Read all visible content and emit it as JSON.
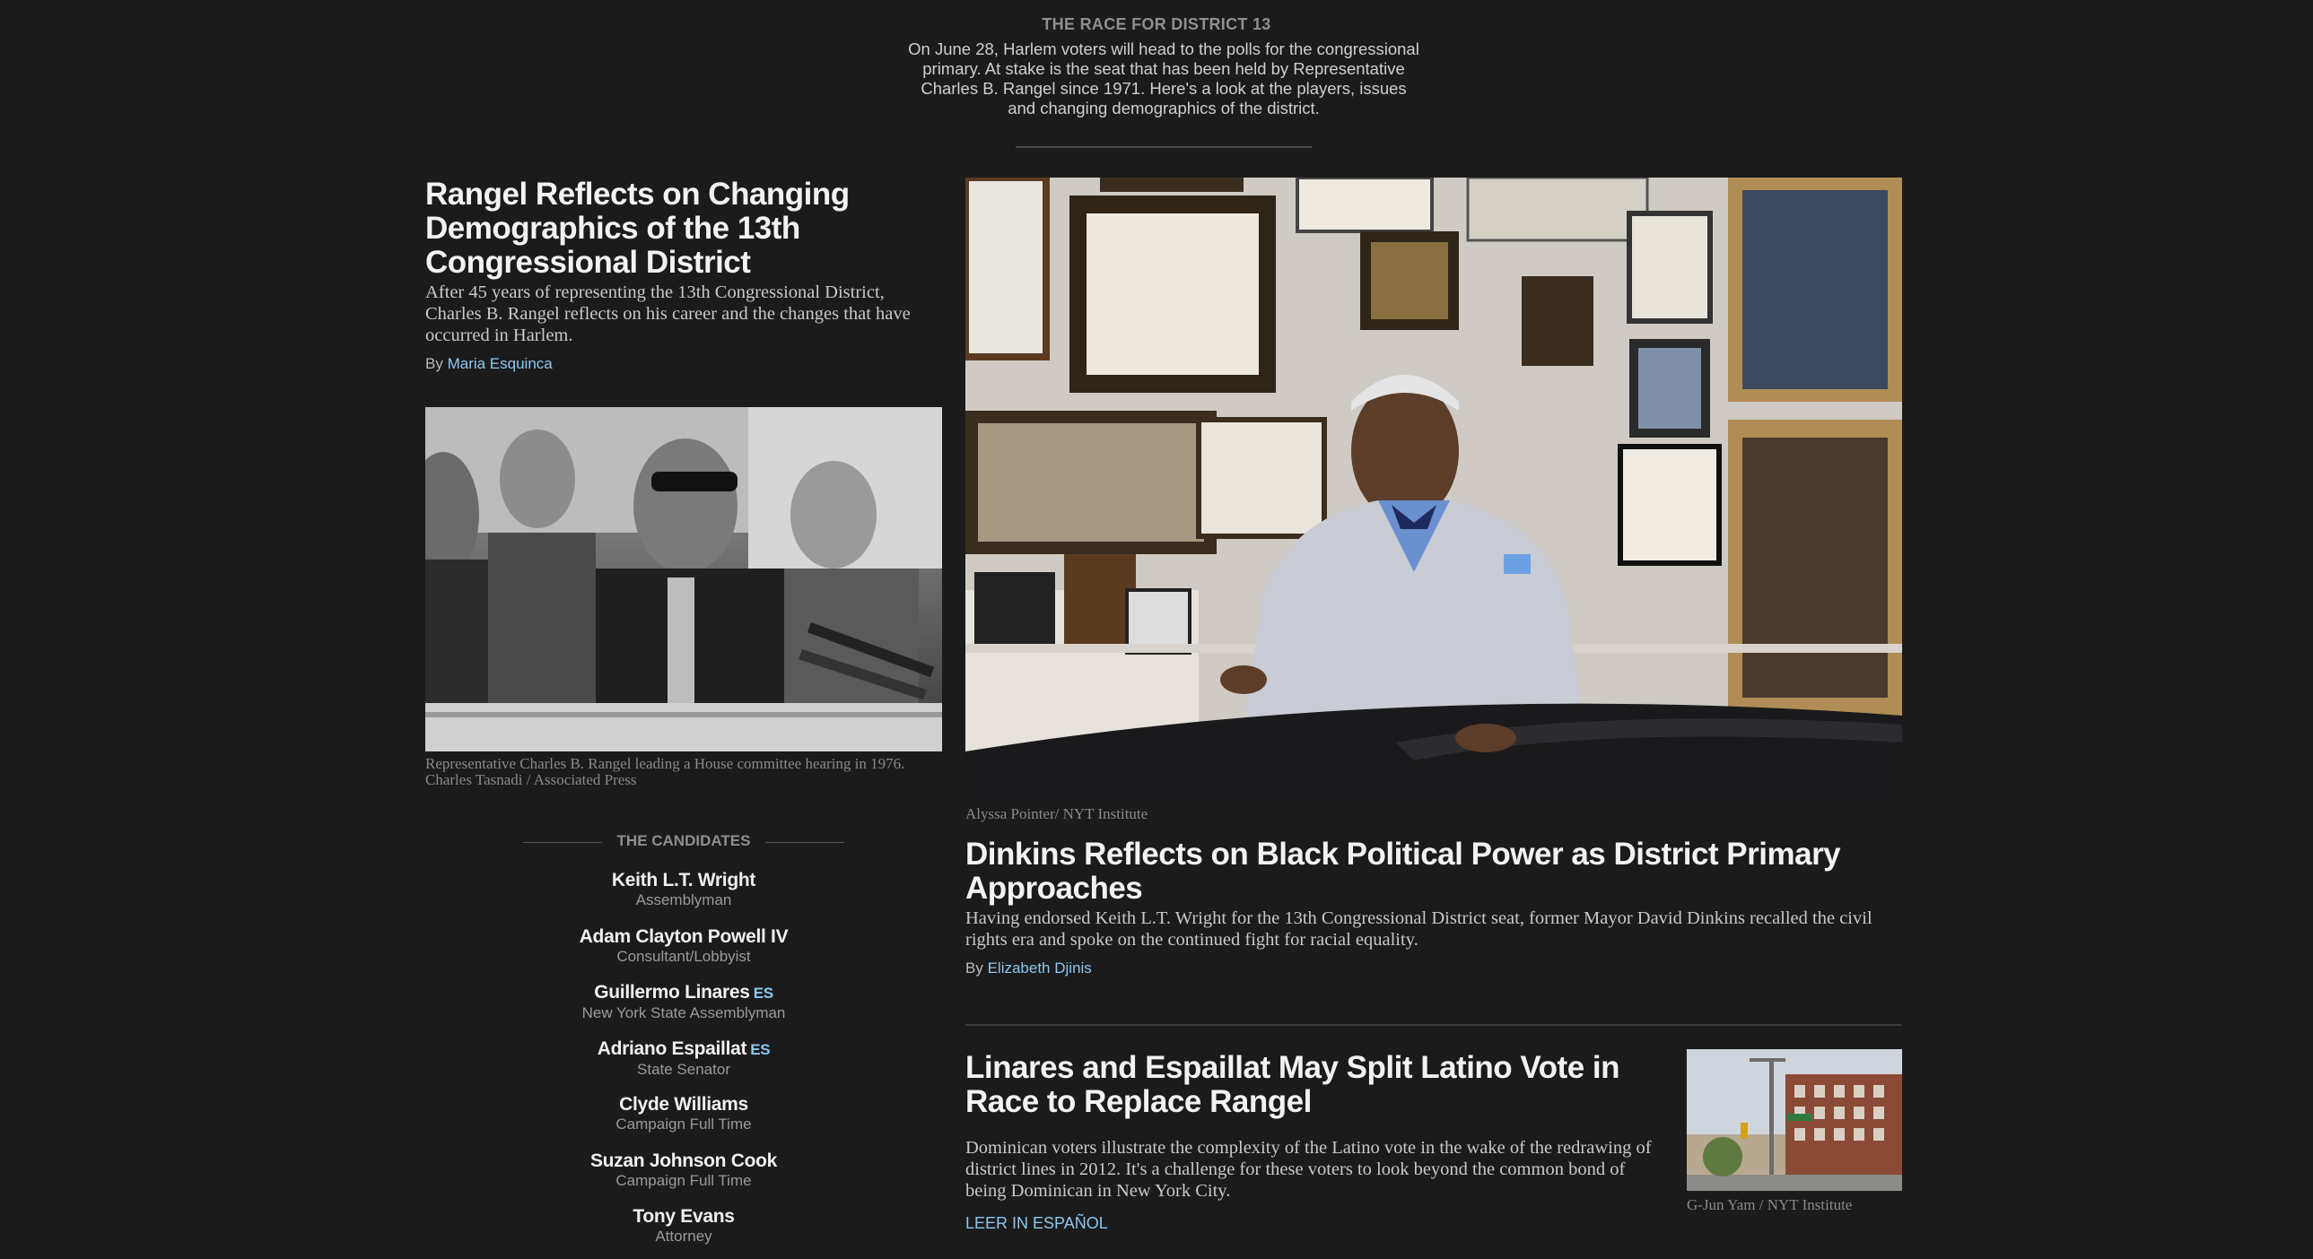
{
  "intro": {
    "kicker": "THE RACE FOR DISTRICT 13",
    "text": "On June 28, Harlem voters will head to the polls for the congressional primary. At stake is the seat that has been held by Representative Charles B. Rangel since 1971. Here's a look at the players, issues and changing demographics of the district."
  },
  "story1": {
    "headline": "Rangel Reflects on Changing Demographics of the 13th Congressional District",
    "summary": "After 45 years of representing the 13th Congressional District, Charles B. Rangel reflects on his career and the changes that have occurred in Harlem.",
    "byline_prefix": "By",
    "author": "Maria Esquinca",
    "photo_caption": "Representative Charles B. Rangel leading a House committee hearing in 1976. Charles Tasnadi / Associated Press"
  },
  "candidates": {
    "header": "THE CANDIDATES",
    "items": [
      {
        "name": "Keith L.T. Wright",
        "role": "Assemblyman",
        "es": ""
      },
      {
        "name": "Adam Clayton Powell IV",
        "role": "Consultant/Lobbyist",
        "es": ""
      },
      {
        "name": "Guillermo Linares",
        "role": "New York State Assemblyman",
        "es": "ES"
      },
      {
        "name": "Adriano Espaillat",
        "role": "State Senator",
        "es": "ES"
      },
      {
        "name": "Clyde Williams",
        "role": "Campaign Full Time",
        "es": ""
      },
      {
        "name": "Suzan Johnson Cook",
        "role": "Campaign Full Time",
        "es": ""
      },
      {
        "name": "Tony Evans",
        "role": "Attorney",
        "es": ""
      }
    ]
  },
  "story2": {
    "photo_credit": "Alyssa Pointer/ NYT Institute",
    "headline": "Dinkins Reflects on Black Political Power as District Primary Approaches",
    "summary": "Having endorsed Keith L.T. Wright for the 13th Congressional District seat, former Mayor David Dinkins recalled the civil rights era and spoke on the continued fight for racial equality.",
    "byline_prefix": "By",
    "author": "Elizabeth Djinis"
  },
  "story3": {
    "headline": "Linares and Espaillat May Split Latino Vote in Race to Replace Rangel",
    "summary": "Dominican voters illustrate the complexity of the Latino vote in the wake of the redrawing of district lines in 2012. It's a challenge for these voters to look beyond the common bond of being Dominican in New York City.",
    "leer_link": "LEER IN ESPAÑOL",
    "photo_credit": "G-Jun Yam / NYT Institute"
  },
  "colors": {
    "background": "#1b1b1b",
    "link": "#8cc8f0",
    "headline": "#f2f2f2"
  }
}
